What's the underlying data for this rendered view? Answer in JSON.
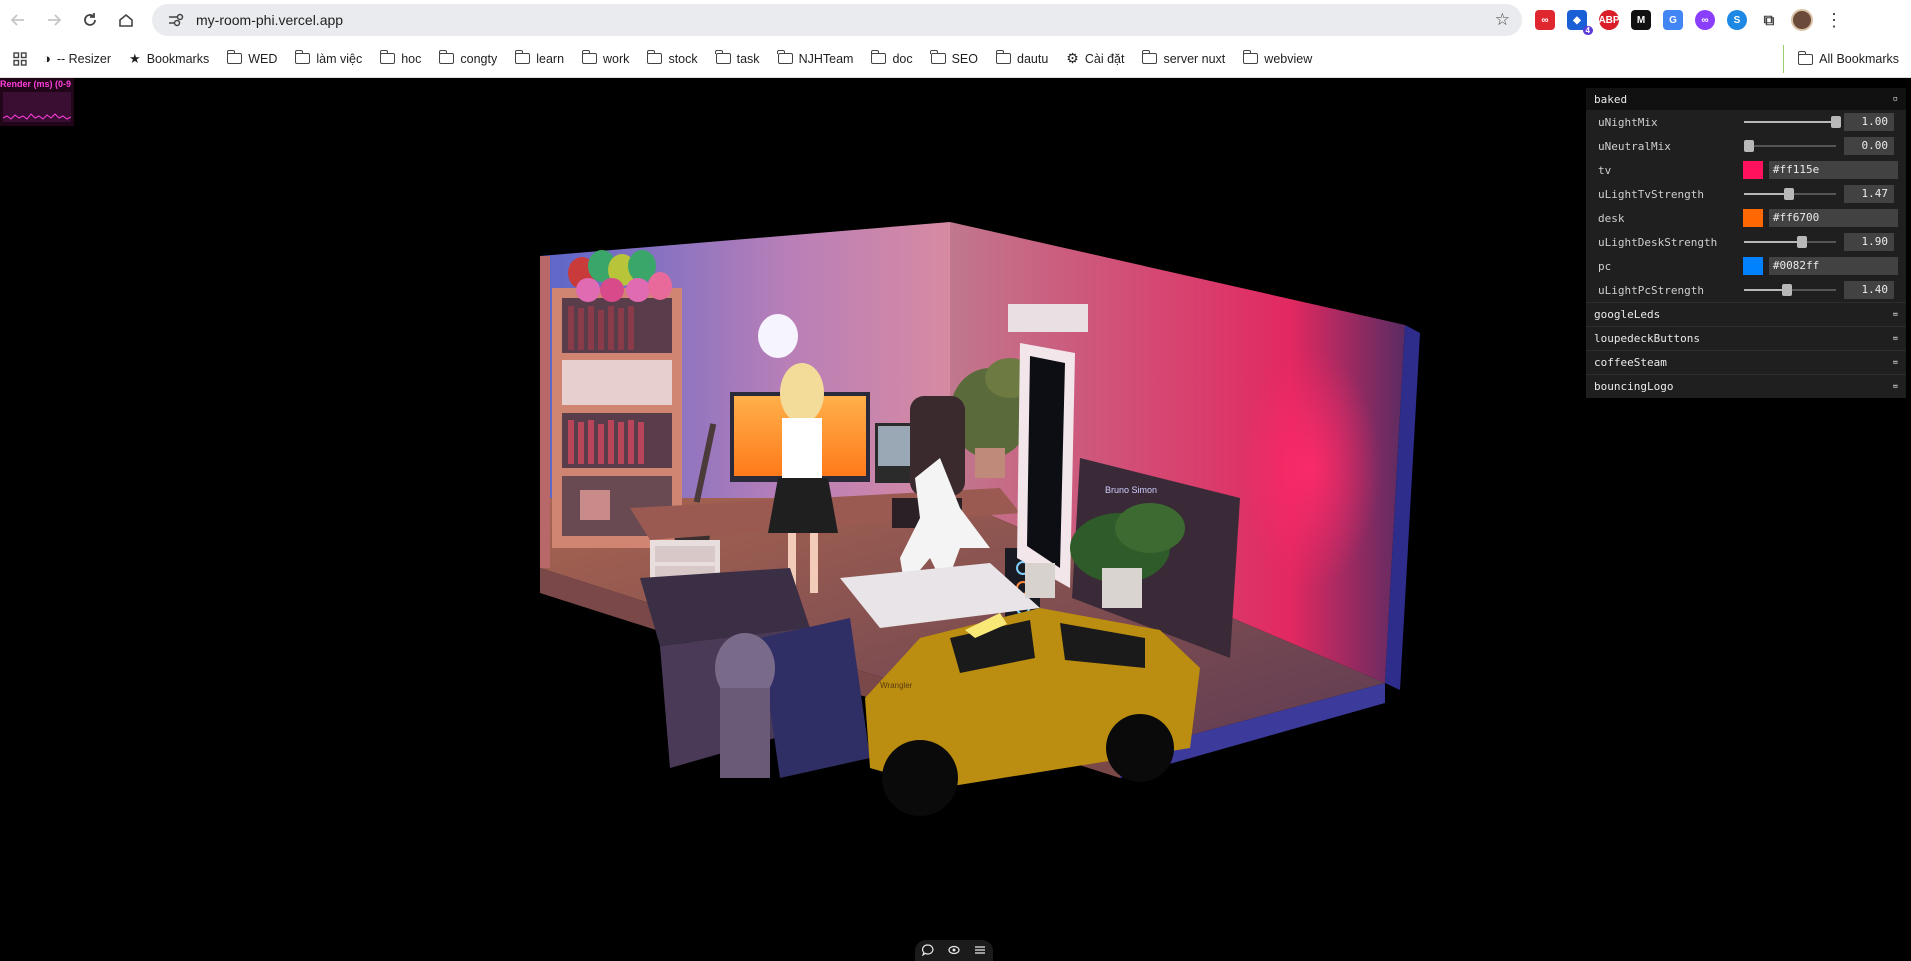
{
  "browser": {
    "url": "my-room-phi.vercel.app",
    "bookmarks": [
      {
        "label": "-- Resizer",
        "icon": "resizer-icon"
      },
      {
        "label": "Bookmarks",
        "icon": "star-icon"
      },
      {
        "label": "WED",
        "icon": "folder-icon"
      },
      {
        "label": "làm việc",
        "icon": "folder-icon"
      },
      {
        "label": "hoc",
        "icon": "folder-icon"
      },
      {
        "label": "congty",
        "icon": "folder-icon"
      },
      {
        "label": "learn",
        "icon": "folder-icon"
      },
      {
        "label": "work",
        "icon": "folder-icon"
      },
      {
        "label": "stock",
        "icon": "folder-icon"
      },
      {
        "label": "task",
        "icon": "folder-icon"
      },
      {
        "label": "NJHTeam",
        "icon": "folder-icon"
      },
      {
        "label": "doc",
        "icon": "folder-icon"
      },
      {
        "label": "SEO",
        "icon": "folder-icon"
      },
      {
        "label": "dautu",
        "icon": "folder-icon"
      },
      {
        "label": "Cài đặt",
        "icon": "gear-icon"
      },
      {
        "label": "server nuxt",
        "icon": "folder-icon"
      },
      {
        "label": "webview",
        "icon": "folder-icon"
      }
    ],
    "all_bookmarks": "All Bookmarks",
    "extension_badge": "4"
  },
  "stats": {
    "label": "Render (ms) (0-9"
  },
  "gui": {
    "title": "baked",
    "controls": [
      {
        "type": "slider",
        "label": "uNightMix",
        "value": "1.00",
        "fraction": 1.0
      },
      {
        "type": "slider",
        "label": "uNeutralMix",
        "value": "0.00",
        "fraction": 0.0
      },
      {
        "type": "color",
        "label": "tv",
        "value": "#ff115e"
      },
      {
        "type": "slider",
        "label": "uLightTvStrength",
        "value": "1.47",
        "fraction": 0.49
      },
      {
        "type": "color",
        "label": "desk",
        "value": "#ff6700"
      },
      {
        "type": "slider",
        "label": "uLightDeskStrength",
        "value": "1.90",
        "fraction": 0.63
      },
      {
        "type": "color",
        "label": "pc",
        "value": "#0082ff"
      },
      {
        "type": "slider",
        "label": "uLightPcStrength",
        "value": "1.40",
        "fraction": 0.47
      }
    ],
    "folders": [
      "googleLeds",
      "loupedeckButtons",
      "coffeeSteam",
      "bouncingLogo"
    ]
  },
  "scene": {
    "car_text": "Wrangler",
    "tv_text": "Bruno Simon"
  }
}
